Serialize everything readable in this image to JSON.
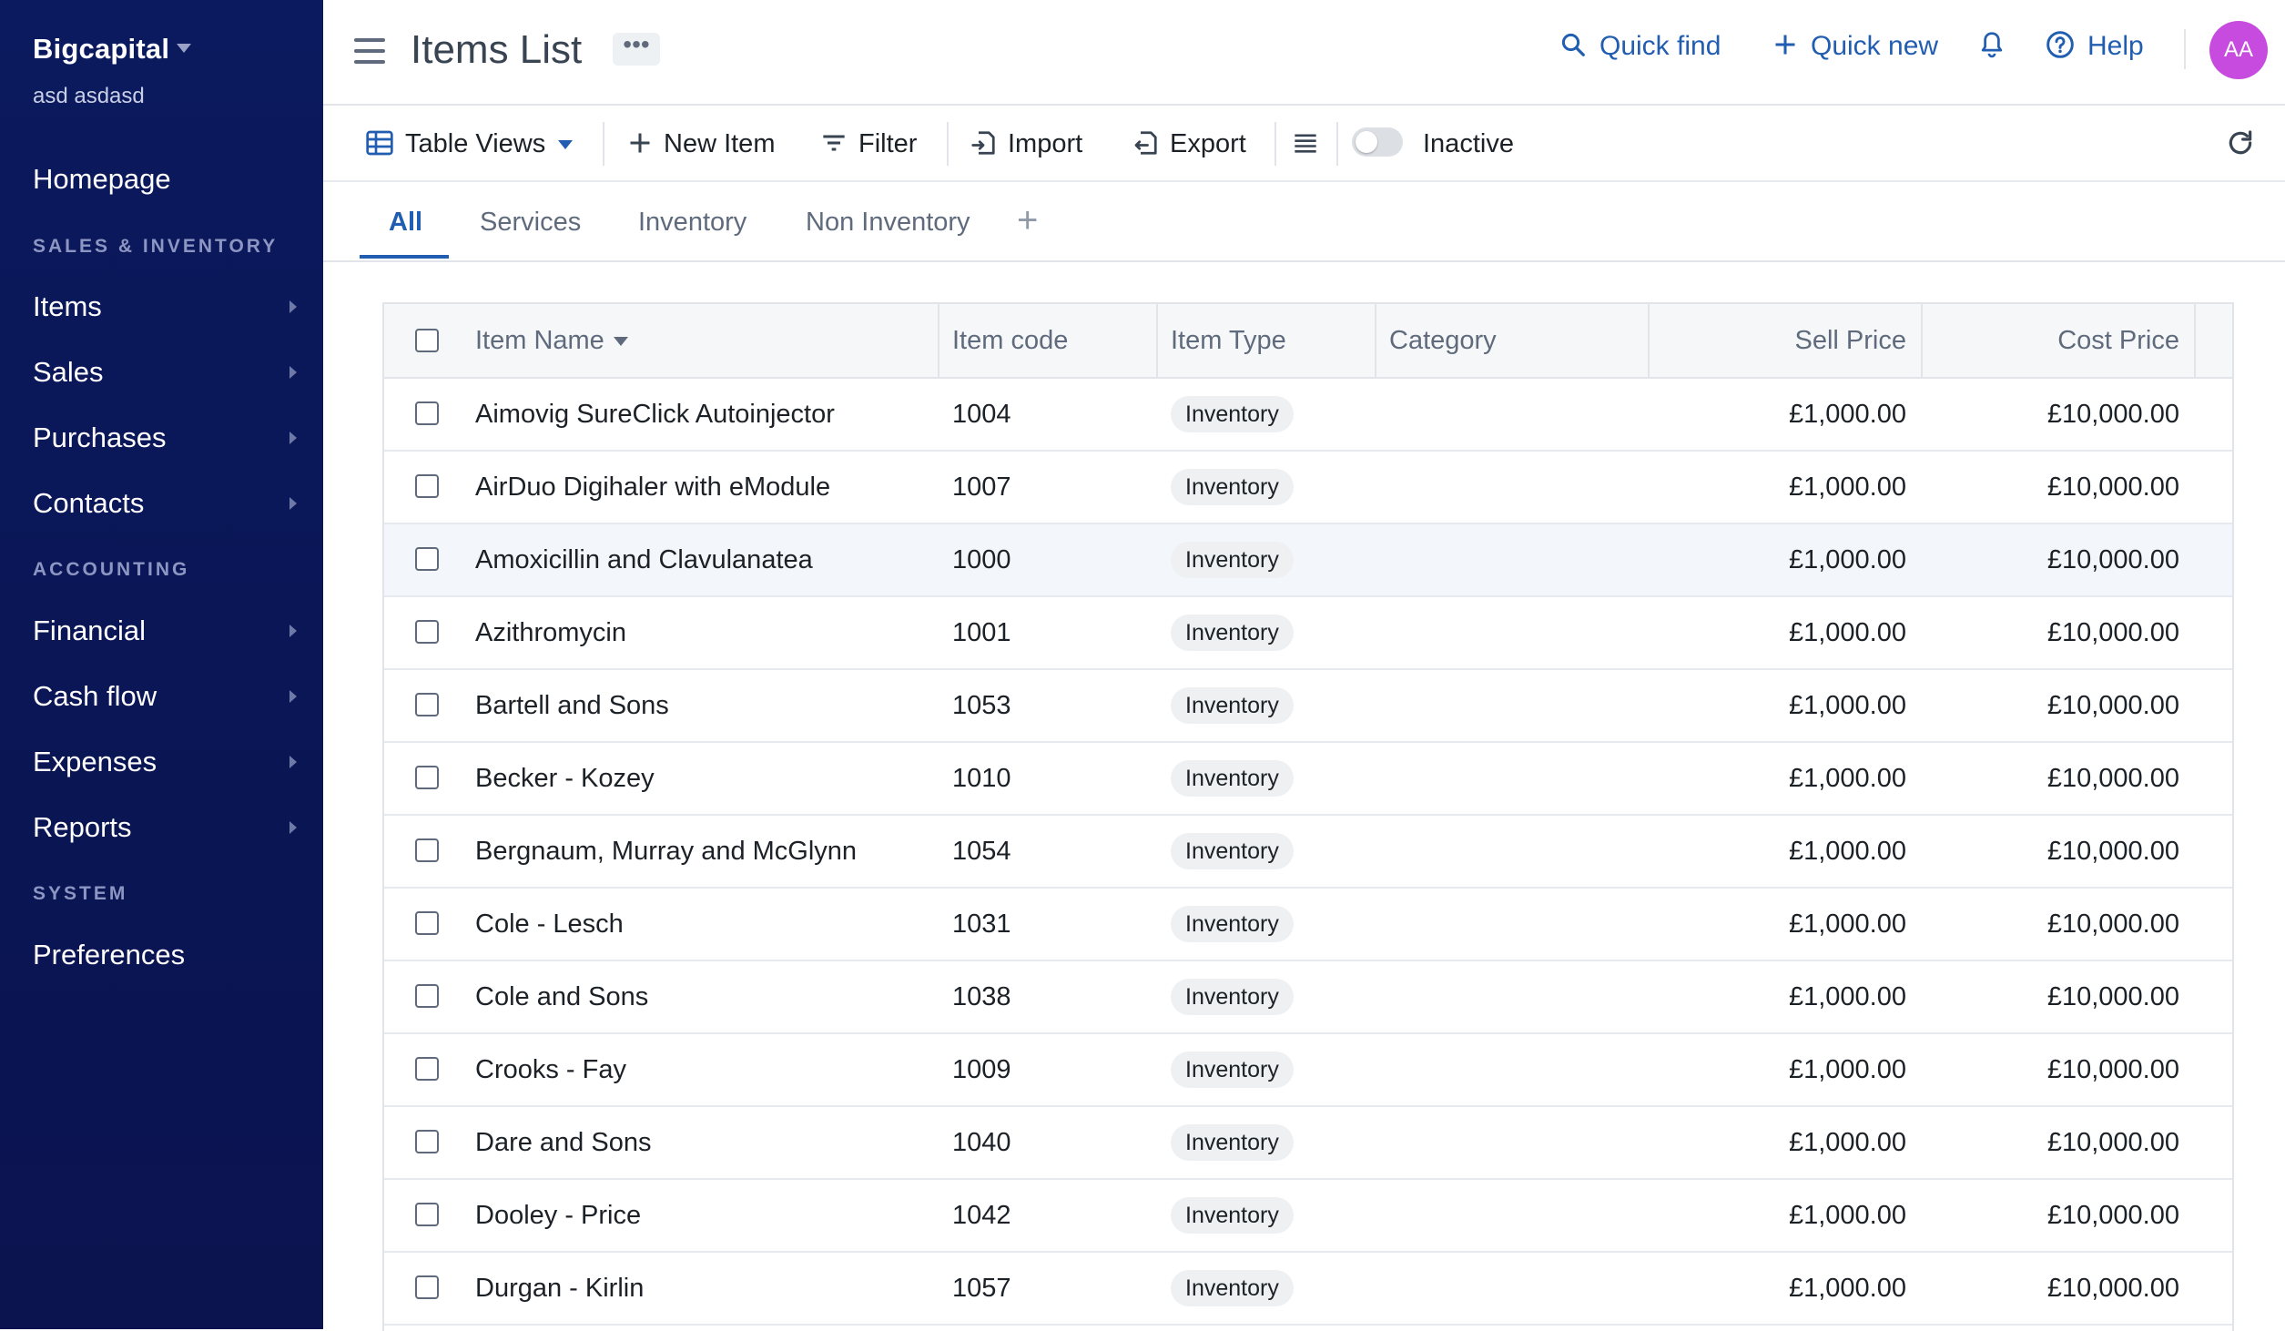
{
  "sidebar": {
    "org_name": "Bigcapital",
    "user_name": "asd asdasd",
    "homepage": "Homepage",
    "sections": {
      "sales_inventory": "SALES & INVENTORY",
      "accounting": "ACCOUNTING",
      "system": "SYSTEM"
    },
    "items": [
      "Items",
      "Sales",
      "Purchases",
      "Contacts",
      "Financial",
      "Cash flow",
      "Expenses",
      "Reports"
    ],
    "preferences": "Preferences"
  },
  "header": {
    "title": "Items List",
    "more": "•••",
    "quick_find": "Quick find",
    "quick_new": "Quick new",
    "help": "Help",
    "avatar": "AA"
  },
  "toolbar": {
    "table_views": "Table Views",
    "new_item": "New Item",
    "filter": "Filter",
    "import": "Import",
    "export": "Export",
    "inactive": "Inactive",
    "inactive_on": false
  },
  "tabs": {
    "items": [
      "All",
      "Services",
      "Inventory",
      "Non Inventory"
    ],
    "active": "All"
  },
  "table": {
    "columns": [
      "Item Name",
      "Item code",
      "Item Type",
      "Category",
      "Sell Price",
      "Cost Price"
    ],
    "rows": [
      {
        "name": "Aimovig SureClick Autoinjector",
        "code": "1004",
        "type": "Inventory",
        "category": "",
        "sell": "£1,000.00",
        "cost": "£10,000.00"
      },
      {
        "name": "AirDuo Digihaler with eModule",
        "code": "1007",
        "type": "Inventory",
        "category": "",
        "sell": "£1,000.00",
        "cost": "£10,000.00"
      },
      {
        "name": "Amoxicillin and Clavulanatea",
        "code": "1000",
        "type": "Inventory",
        "category": "",
        "sell": "£1,000.00",
        "cost": "£10,000.00"
      },
      {
        "name": "Azithromycin",
        "code": "1001",
        "type": "Inventory",
        "category": "",
        "sell": "£1,000.00",
        "cost": "£10,000.00"
      },
      {
        "name": "Bartell and Sons",
        "code": "1053",
        "type": "Inventory",
        "category": "",
        "sell": "£1,000.00",
        "cost": "£10,000.00"
      },
      {
        "name": "Becker - Kozey",
        "code": "1010",
        "type": "Inventory",
        "category": "",
        "sell": "£1,000.00",
        "cost": "£10,000.00"
      },
      {
        "name": "Bergnaum, Murray and McGlynn",
        "code": "1054",
        "type": "Inventory",
        "category": "",
        "sell": "£1,000.00",
        "cost": "£10,000.00"
      },
      {
        "name": "Cole - Lesch",
        "code": "1031",
        "type": "Inventory",
        "category": "",
        "sell": "£1,000.00",
        "cost": "£10,000.00"
      },
      {
        "name": "Cole and Sons",
        "code": "1038",
        "type": "Inventory",
        "category": "",
        "sell": "£1,000.00",
        "cost": "£10,000.00"
      },
      {
        "name": "Crooks - Fay",
        "code": "1009",
        "type": "Inventory",
        "category": "",
        "sell": "£1,000.00",
        "cost": "£10,000.00"
      },
      {
        "name": "Dare and Sons",
        "code": "1040",
        "type": "Inventory",
        "category": "",
        "sell": "£1,000.00",
        "cost": "£10,000.00"
      },
      {
        "name": "Dooley - Price",
        "code": "1042",
        "type": "Inventory",
        "category": "",
        "sell": "£1,000.00",
        "cost": "£10,000.00"
      },
      {
        "name": "Durgan - Kirlin",
        "code": "1057",
        "type": "Inventory",
        "category": "",
        "sell": "£1,000.00",
        "cost": "£10,000.00"
      }
    ]
  },
  "colors": {
    "sidebar_bg": "#0b1a5e",
    "accent": "#215db0",
    "avatar": "#c74bde"
  }
}
